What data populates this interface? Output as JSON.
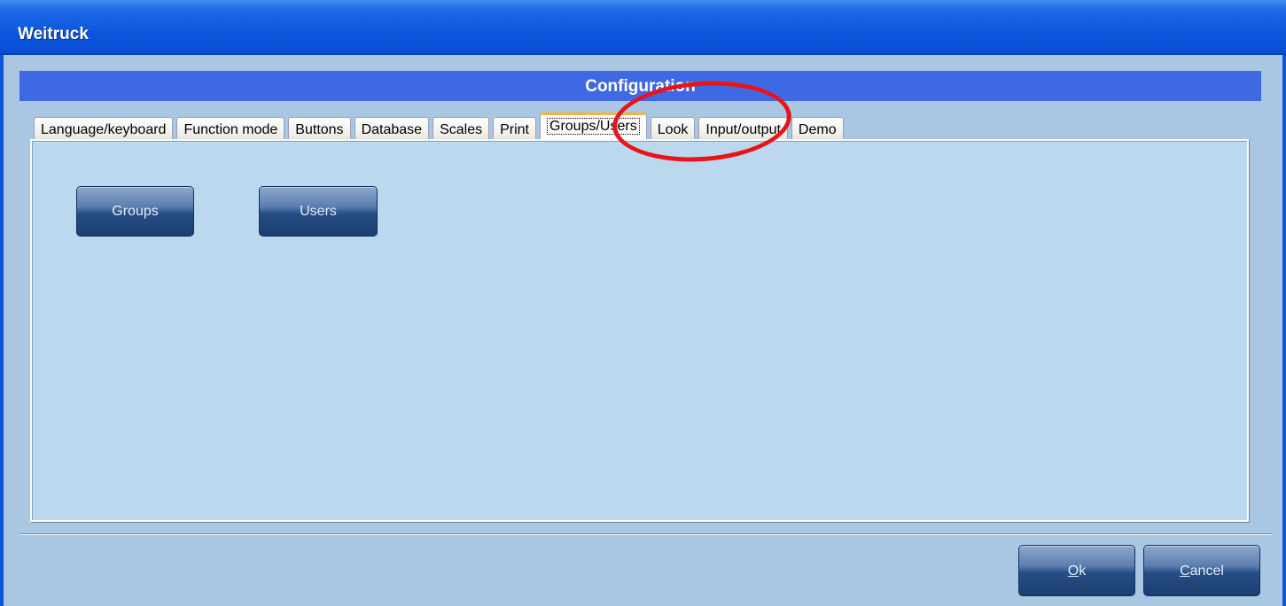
{
  "window": {
    "title": "Weitruck"
  },
  "header": {
    "title": "Configuration"
  },
  "tabs": [
    {
      "label": "Language/keyboard",
      "active": false
    },
    {
      "label": "Function mode",
      "active": false
    },
    {
      "label": "Buttons",
      "active": false
    },
    {
      "label": "Database",
      "active": false
    },
    {
      "label": "Scales",
      "active": false
    },
    {
      "label": "Print",
      "active": false
    },
    {
      "label": "Groups/Users",
      "active": true
    },
    {
      "label": "Look",
      "active": false
    },
    {
      "label": "Input/output",
      "active": false
    },
    {
      "label": "Demo",
      "active": false
    }
  ],
  "panel": {
    "groups_label": "Groups",
    "users_label": "Users"
  },
  "footer": {
    "ok_first": "O",
    "ok_rest": "k",
    "cancel_first": "C",
    "cancel_rest": "ancel"
  },
  "colors": {
    "titlebar": "#0b56dd",
    "header_bar": "#3e69e2",
    "panel_bg": "#bbd8ee",
    "window_bg": "#a9c6e2",
    "active_tab_accent": "#f5b33a",
    "annotation_circle": "#e8141a"
  }
}
